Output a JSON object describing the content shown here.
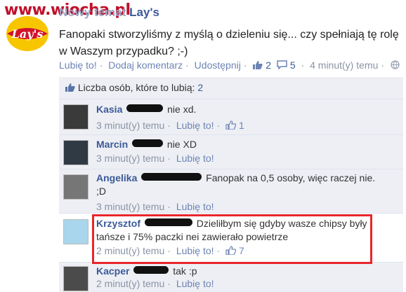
{
  "watermark": "www.wiocha.pl",
  "post": {
    "author": "Lay's",
    "author_prefix": "Nowy temat",
    "text": "Fanopaki stworzyliśmy z myślą o dzieleniu się... czy spełniają tę rolę w Waszym przypadku? ;-)",
    "actions": {
      "like": "Lubię to!",
      "comment": "Dodaj komentarz",
      "share": "Udostępnij",
      "likes_count": "2",
      "comments_count": "5",
      "time": "4 minut(y) temu"
    }
  },
  "likes_summary": {
    "label": "Liczba osób, które to lubią:",
    "count": "2"
  },
  "comments": [
    {
      "name": "Kasia",
      "text": "nie xd.",
      "time": "3 minut(y) temu",
      "like": "Lubię to!",
      "likes": "1"
    },
    {
      "name": "Marcin",
      "text": "nie XD",
      "time": "3 minut(y) temu",
      "like": "Lubię to!",
      "likes": ""
    },
    {
      "name": "Angelika",
      "text": "Fanopak na 0,5 osoby, więc raczej nie.",
      "text2": ";D",
      "time": "3 minut(y) temu",
      "like": "Lubię to!",
      "likes": ""
    },
    {
      "name": "Krzysztof",
      "text": "Dzieliłbym się gdyby wasze chipsy były",
      "text2": "tańsze i 75% paczki nei zawierało powietrze",
      "time": "2 minut(y) temu",
      "like": "Lubię to!",
      "likes": "7"
    },
    {
      "name": "Kacper",
      "text": "tak :p",
      "time": "2 minut(y) temu",
      "like": "Lubię to!",
      "likes": ""
    }
  ],
  "colors": {
    "link": "#3b5998",
    "highlight": "#e8262b",
    "box": "#edeff4"
  }
}
